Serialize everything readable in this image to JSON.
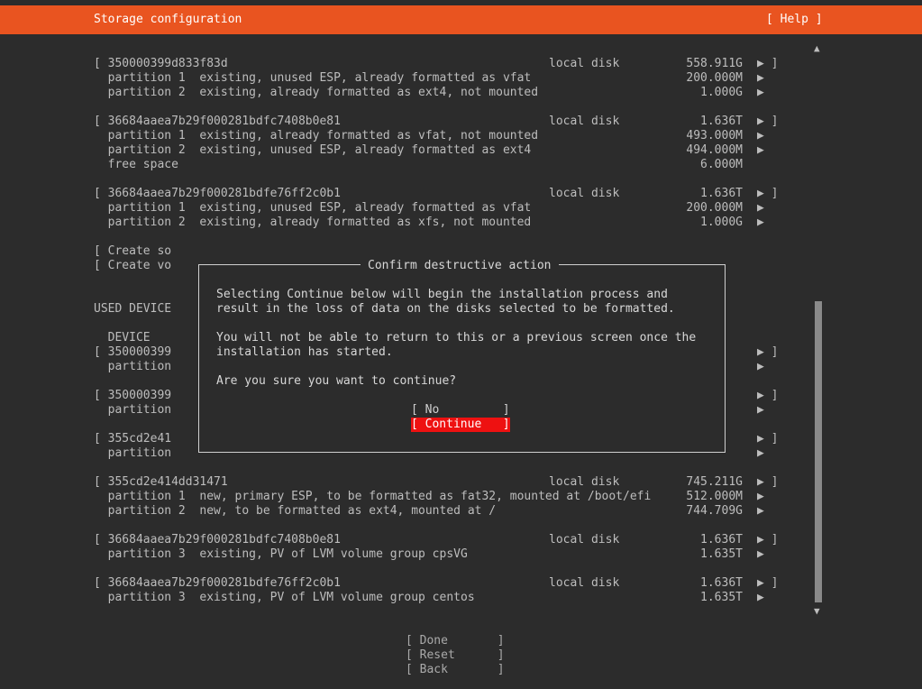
{
  "header": {
    "title": "Storage configuration",
    "help": "[ Help ]"
  },
  "available": [
    {
      "name": "[ 350000399d833f83d",
      "type": "local disk",
      "size": "558.911G",
      "arrow": "▶ ]"
    },
    {
      "name": "  partition 1  existing, unused ESP, already formatted as vfat",
      "size": "200.000M",
      "arrow": "▶"
    },
    {
      "name": "  partition 2  existing, already formatted as ext4, not mounted",
      "size": "1.000G",
      "arrow": "▶"
    },
    {
      "name": "[ 36684aaea7b29f000281bdfc7408b0e81",
      "type": "local disk",
      "size": "1.636T",
      "arrow": "▶ ]"
    },
    {
      "name": "  partition 1  existing, already formatted as vfat, not mounted",
      "size": "493.000M",
      "arrow": "▶"
    },
    {
      "name": "  partition 2  existing, unused ESP, already formatted as ext4",
      "size": "494.000M",
      "arrow": "▶"
    },
    {
      "name": "  free space",
      "size": "6.000M",
      "arrow": ""
    },
    {
      "name": "[ 36684aaea7b29f000281bdfe76ff2c0b1",
      "type": "local disk",
      "size": "1.636T",
      "arrow": "▶ ]"
    },
    {
      "name": "  partition 1  existing, unused ESP, already formatted as vfat",
      "size": "200.000M",
      "arrow": "▶"
    },
    {
      "name": "  partition 2  existing, already formatted as xfs, not mounted",
      "size": "1.000G",
      "arrow": "▶"
    }
  ],
  "create_actions": [
    "[ Create so",
    "[ Create vo"
  ],
  "used_header": "USED DEVICE",
  "used_col_header": "  DEVICE",
  "used_partial": [
    {
      "name": "[ 350000399",
      "arrow": "▶ ]"
    },
    {
      "name": "  partition",
      "arrow": "▶"
    },
    {
      "name": "[ 350000399",
      "arrow": "▶ ]"
    },
    {
      "name": "  partition",
      "arrow": "▶"
    },
    {
      "name": "[ 355cd2e41",
      "arrow": "▶ ]"
    },
    {
      "name": "  partition",
      "arrow": "▶"
    }
  ],
  "used_full": [
    {
      "name": "[ 355cd2e414dd31471",
      "type": "local disk",
      "size": "745.211G",
      "arrow": "▶ ]"
    },
    {
      "name": "  partition 1  new, primary ESP, to be formatted as fat32, mounted at /boot/efi",
      "size": "512.000M",
      "arrow": "▶"
    },
    {
      "name": "  partition 2  new, to be formatted as ext4, mounted at /",
      "size": "744.709G",
      "arrow": "▶"
    },
    {
      "name": "[ 36684aaea7b29f000281bdfc7408b0e81",
      "type": "local disk",
      "size": "1.636T",
      "arrow": "▶ ]"
    },
    {
      "name": "  partition 3  existing, PV of LVM volume group cpsVG",
      "size": "1.635T",
      "arrow": "▶"
    },
    {
      "name": "[ 36684aaea7b29f000281bdfe76ff2c0b1",
      "type": "local disk",
      "size": "1.636T",
      "arrow": "▶ ]"
    },
    {
      "name": "  partition 3  existing, PV of LVM volume group centos",
      "size": "1.635T",
      "arrow": "▶"
    }
  ],
  "dialog": {
    "title": "Confirm destructive action",
    "line1": "Selecting Continue below will begin the installation process and",
    "line2": "result in the loss of data on the disks selected to be formatted.",
    "line3": "You will not be able to return to this or a previous screen once the",
    "line4": "installation has started.",
    "line5": "Are you sure you want to continue?",
    "no": "[ No         ]",
    "continue": "[ Continue   ]"
  },
  "bottom": {
    "done": "[ Done       ]",
    "reset": "[ Reset      ]",
    "back": "[ Back       ]"
  },
  "scroll": {
    "up": "▲",
    "down": "▼"
  }
}
